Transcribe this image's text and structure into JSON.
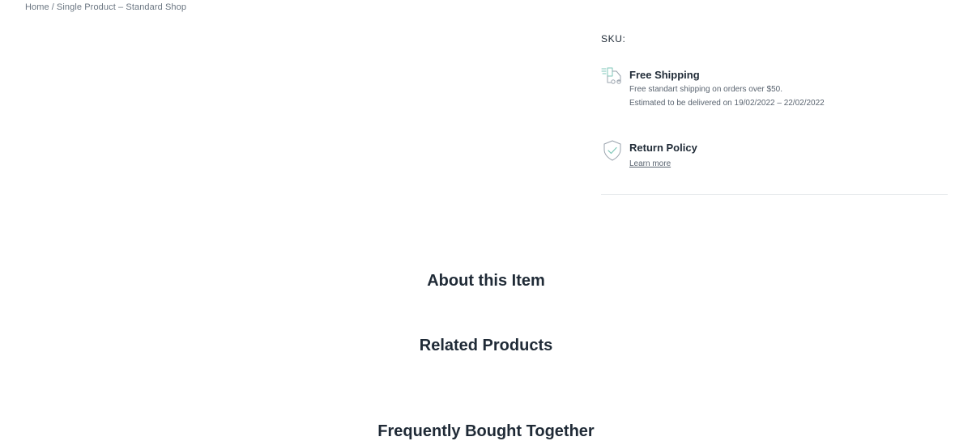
{
  "breadcrumb": {
    "items": [
      "Home",
      "Single Product – Standard Shop"
    ],
    "separator": "/"
  },
  "product": {
    "sku_label": "SKU:"
  },
  "features": {
    "shipping": {
      "icon": "truck-icon",
      "title": "Free Shipping",
      "line1": "Free standart shipping on orders over $50.",
      "line2": "Estimated to be delivered on 19/02/2022 – 22/02/2022"
    },
    "returns": {
      "icon": "shield-check-icon",
      "title": "Return Policy",
      "link": "Learn more"
    }
  },
  "sections": {
    "about": "About this Item",
    "related": "Related Products",
    "bought_together": "Frequently Bought Together"
  },
  "colors": {
    "text": "#1f2a36",
    "muted": "#6b7682",
    "icon_accent": "#7fc7b8",
    "divider": "#e6e9ec"
  }
}
